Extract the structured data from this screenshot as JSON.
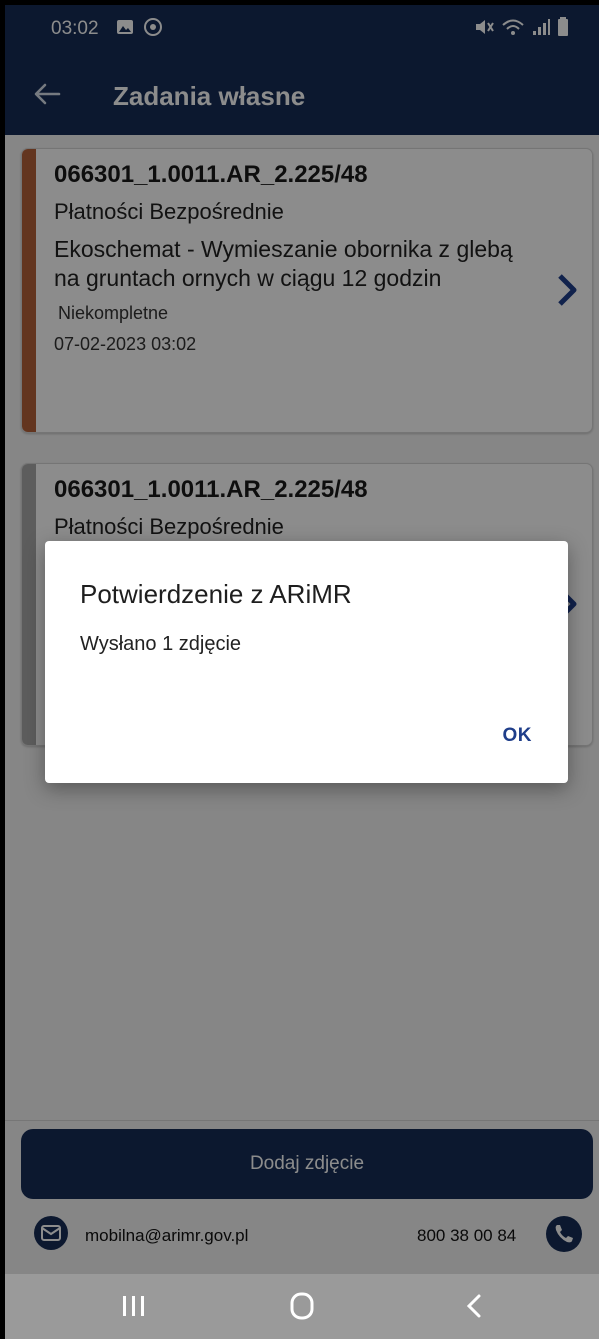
{
  "status_bar": {
    "time": "03:02"
  },
  "app_bar": {
    "title": "Zadania własne"
  },
  "cards": [
    {
      "id": "066301_1.0011.AR_2.225/48",
      "program": "Płatności Bezpośrednie",
      "description": "Ekoschemat - Wymieszanie obornika z glebą na gruntach ornych w ciągu 12 godzin",
      "status": "Niekompletne",
      "date": "07-02-2023 03:02",
      "stripe_color": "#b5623a"
    },
    {
      "id": "066301_1.0011.AR_2.225/48",
      "program": "Płatności Bezpośrednie",
      "stripe_color": "#a9a9a9"
    }
  ],
  "dialog": {
    "title": "Potwierdzenie z ARiMR",
    "message": "Wysłano 1 zdjęcie",
    "ok_label": "OK"
  },
  "bottom": {
    "add_photo_label": "Dodaj zdjęcie",
    "email": "mobilna@arimr.gov.pl",
    "phone": "800 38 00 84"
  },
  "colors": {
    "primary": "#162d57",
    "accent_chevron": "#1f3e8a",
    "card1_stripe": "#b5623a"
  }
}
